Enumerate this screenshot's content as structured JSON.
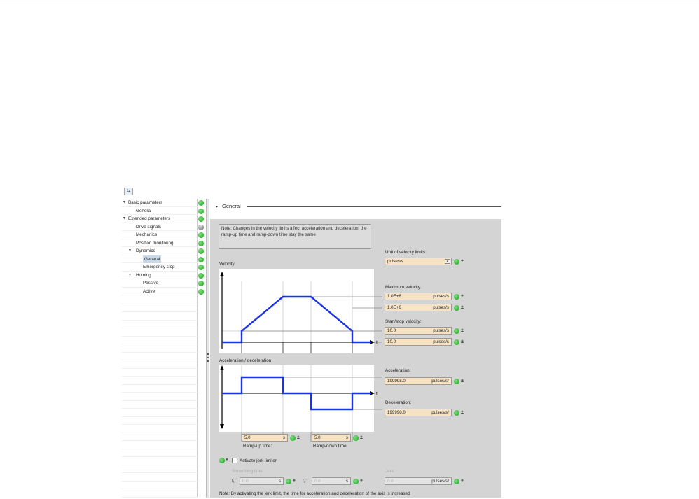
{
  "toolbar": {
    "icon": "parameter-view-icon"
  },
  "tree": {
    "items": [
      {
        "label": "Basic parameters",
        "level": 0,
        "expanded": true,
        "status": "ok"
      },
      {
        "label": "General",
        "level": 1,
        "status": "ok"
      },
      {
        "label": "Extended parameters",
        "level": 0,
        "expanded": true,
        "status": "ok"
      },
      {
        "label": "Drive signals",
        "level": 1,
        "status": "help"
      },
      {
        "label": "Mechanics",
        "level": 1,
        "status": "ok"
      },
      {
        "label": "Position monitoring",
        "level": 1,
        "status": "ok"
      },
      {
        "label": "Dynamics",
        "level": 1,
        "expanded": true,
        "status": "ok"
      },
      {
        "label": "General",
        "level": 2,
        "selected": true,
        "status": "ok"
      },
      {
        "label": "Emergency stop",
        "level": 2,
        "status": "ok"
      },
      {
        "label": "Homing",
        "level": 1,
        "expanded": true,
        "status": "ok"
      },
      {
        "label": "Passive",
        "level": 2,
        "status": "ok"
      },
      {
        "label": "Active",
        "level": 2,
        "status": "ok"
      }
    ]
  },
  "section": {
    "title": "General"
  },
  "note_top": "Note: Changes in the velocity limits affect acceleration and deceleration; the ramp-up time and ramp-down time stay the same",
  "velocity_graph": {
    "label": "Velocity",
    "axis_t": "t"
  },
  "accel_graph": {
    "label": "Acceleration / deceleration",
    "axis_t": "t"
  },
  "unit_of_velocity_limits": {
    "label": "Unit of velocity limits:",
    "value": "pulses/s"
  },
  "maximum_velocity": {
    "label": "Maximum velocity:",
    "value1": "1.0E+6",
    "value2": "1.0E+6",
    "unit": "pulses/s"
  },
  "start_stop_velocity": {
    "label": "Start/stop velocity:",
    "value1": "10.0",
    "value2": "10.0",
    "unit": "pulses/s"
  },
  "acceleration": {
    "label": "Acceleration:",
    "value": "199998.0",
    "unit": "pulses/s²"
  },
  "deceleration": {
    "label": "Deceleration:",
    "value": "199998.0",
    "unit": "pulses/s²"
  },
  "ramp_up": {
    "label": "Ramp-up time:",
    "value": "5.0",
    "unit": "s"
  },
  "ramp_down": {
    "label": "Ramp-down time:",
    "value": "5.0",
    "unit": "s"
  },
  "jerk_limiter": {
    "checkbox_label": "Activate jerk limiter",
    "checked": false,
    "smoothing_label": "Smoothing time:",
    "t1_label": "t₁:",
    "t1_value": "0.0",
    "t2_label": "t₂:",
    "t2_value": "0.0",
    "time_unit": "s",
    "jerk_label": "Jerk:",
    "jerk_value": "0.0",
    "jerk_unit": "pulses/s³"
  },
  "note_bottom": "Note: By activating the jerk limit, the time for acceleration and deceleration of the axis is increased",
  "colors": {
    "curve": "#1a33e6",
    "field_bg": "#f7e2c4",
    "panel_bg": "#d4d4d4",
    "status_ok": "#2aa82a"
  }
}
